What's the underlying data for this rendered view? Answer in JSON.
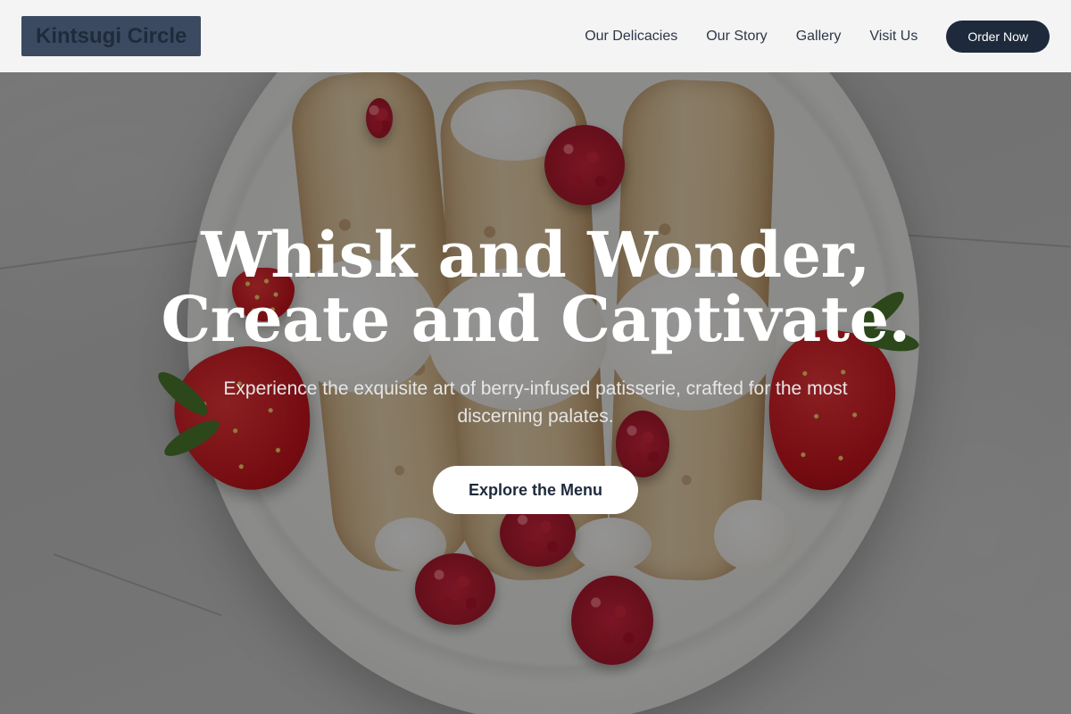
{
  "brand": {
    "logo_text": "Kintsugi Circle"
  },
  "nav": {
    "links": [
      "Our Delicacies",
      "Our Story",
      "Gallery",
      "Visit Us"
    ],
    "order_label": "Order Now"
  },
  "hero": {
    "title_line1": "Whisk and Wonder,",
    "title_line2": "Create and Captivate.",
    "subtitle": "Experience the exquisite art of berry-infused patisserie, crafted for the most discerning palates.",
    "cta_label": "Explore the Menu"
  },
  "colors": {
    "navbar_bg": "#f4f4f4",
    "logo_bg": "#3b4a60",
    "primary_dark": "#1e2a3c",
    "hero_text": "#ffffff"
  }
}
